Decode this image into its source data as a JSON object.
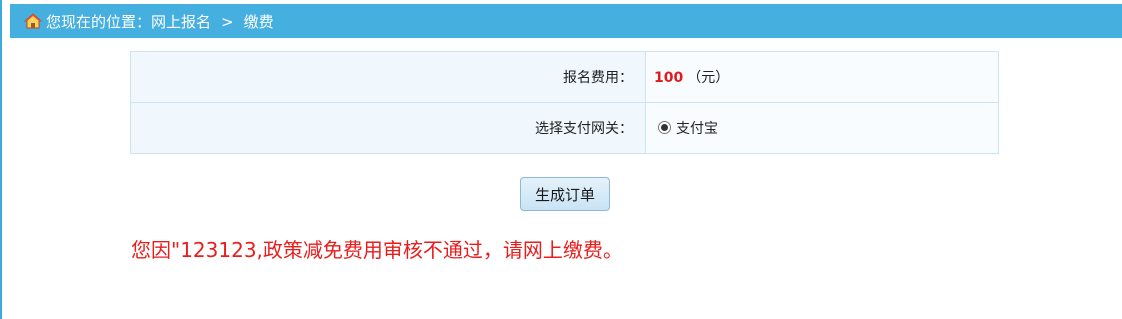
{
  "breadcrumb": {
    "icon": "home-icon",
    "prefix": "您现在的位置：",
    "parent": "网上报名",
    "separator": ">",
    "current": "缴费"
  },
  "fee_table": {
    "fee_label": "报名费用：",
    "fee_amount": "100",
    "fee_unit": "（元）",
    "gateway_label": "选择支付网关：",
    "gateway_option": "支付宝",
    "gateway_selected": true
  },
  "actions": {
    "generate_order": "生成订单"
  },
  "notice": {
    "text": "您因\"123123,政策减免费用审核不通过，请网上缴费。"
  },
  "colors": {
    "header_bg": "#45afdf",
    "amount": "#e11b1b",
    "notice": "#ea1d1d"
  }
}
